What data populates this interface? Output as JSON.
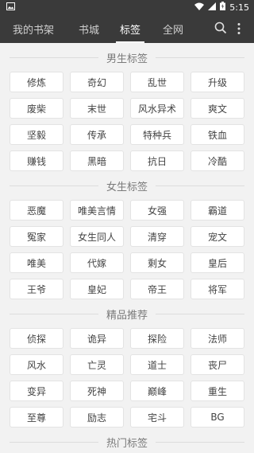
{
  "status_bar": {
    "time": "5:15"
  },
  "nav": {
    "tabs": [
      {
        "label": "我的书架"
      },
      {
        "label": "书城"
      },
      {
        "label": "标签"
      },
      {
        "label": "全网"
      }
    ]
  },
  "sections": [
    {
      "title": "男生标签",
      "tags": [
        "修炼",
        "奇幻",
        "乱世",
        "升级",
        "废柴",
        "末世",
        "风水异术",
        "爽文",
        "坚毅",
        "传承",
        "特种兵",
        "铁血",
        "赚钱",
        "黑暗",
        "抗日",
        "冷酷"
      ]
    },
    {
      "title": "女生标签",
      "tags": [
        "恶魔",
        "唯美言情",
        "女强",
        "霸道",
        "冤家",
        "女生同人",
        "清穿",
        "宠文",
        "唯美",
        "代嫁",
        "剩女",
        "皇后",
        "王爷",
        "皇妃",
        "帝王",
        "将军"
      ]
    },
    {
      "title": "精品推荐",
      "tags": [
        "侦探",
        "诡异",
        "探险",
        "法师",
        "风水",
        "亡灵",
        "道士",
        "丧尸",
        "变异",
        "死神",
        "巅峰",
        "重生",
        "至尊",
        "励志",
        "宅斗",
        "BG"
      ]
    },
    {
      "title": "热门标签",
      "tags": []
    }
  ]
}
